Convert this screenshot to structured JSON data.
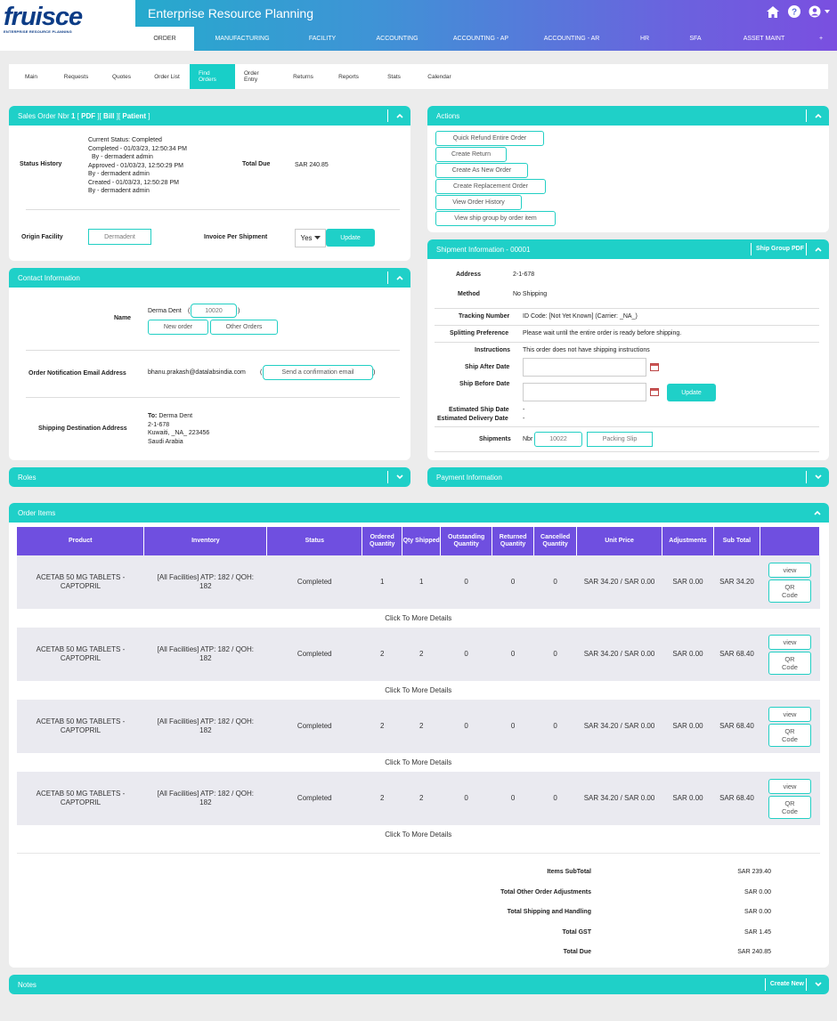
{
  "brand": {
    "logo": "fruisce",
    "tagline": "ENTERPRISE RESOURCE PLANNING"
  },
  "app_title": "Enterprise Resource Planning",
  "main_nav": [
    "ORDER",
    "MANUFACTURING",
    "FACILITY",
    "ACCOUNTING",
    "ACCOUNTING - AP",
    "ACCOUNTING - AR",
    "HR",
    "SFA",
    "ASSET MAINT",
    "+"
  ],
  "sub_nav": [
    "Main",
    "Requests",
    "Quotes",
    "Order List",
    "Find Orders",
    "Order Entry",
    "Returns",
    "Reports",
    "Stats",
    "Calendar"
  ],
  "sales_order": {
    "title_prefix": "Sales Order Nbr",
    "nbr": "1",
    "pdf": "PDF",
    "bill": "Bill",
    "patient": "Patient",
    "status_label": "Status History",
    "status_lines": [
      "Current Status: Completed",
      "Completed - 01/03/23, 12:50:34 PM",
      "By - dermadent admin",
      "Approved - 01/03/23, 12:50:29 PM",
      "By - dermadent admin",
      "Created - 01/03/23, 12:50:28 PM",
      "By - dermadent admin"
    ],
    "total_due_label": "Total Due",
    "total_due": "SAR 240.85",
    "origin_label": "Origin Facility",
    "origin_value": "Dermadent",
    "invoice_label": "Invoice Per Shipment",
    "invoice_value": "Yes",
    "update": "Update"
  },
  "contact": {
    "title": "Contact Information",
    "name_label": "Name",
    "name": "Derma Dent",
    "party_id": "10020",
    "new_order": "New order",
    "other_orders": "Other Orders",
    "email_label": "Order Notification Email Address",
    "email": "bhanu.prakash@datalabsindia.com",
    "send_email": "Send a confirmation email",
    "ship_label": "Shipping Destination Address",
    "to_label": "To:",
    "to_name": "Derma Dent",
    "addr": [
      "2-1-678",
      "Kuwaiti, _NA_ 223456",
      "Saudi Arabia"
    ]
  },
  "roles": {
    "title": "Roles"
  },
  "actions": {
    "title": "Actions",
    "buttons": [
      "Quick Refund Entire Order",
      "Create Return",
      "Create As New Order",
      "Create Replacement Order",
      "View Order History",
      "View ship group by order item"
    ]
  },
  "shipment": {
    "title": "Shipment Information - 00001",
    "pdf": "Ship Group PDF",
    "address_label": "Address",
    "address": "2-1-678",
    "method_label": "Method",
    "method": "No Shipping",
    "tracking_label": "Tracking Number",
    "tracking": "ID Code: [Not Yet Known] (Carrier: _NA_)",
    "split_label": "Splitting Preference",
    "split": "Please wait until the entire order is ready before shipping.",
    "instr_label": "Instructions",
    "instr": "This order does not have shipping instructions",
    "after_label": "Ship After Date",
    "before_label": "Ship Before Date",
    "update": "Update",
    "est_ship_label": "Estimated Ship Date",
    "est_ship": "-",
    "est_deliv_label": "Estimated Delivery Date",
    "est_deliv": "-",
    "shipments_label": "Shipments",
    "nbr_label": "Nbr",
    "nbr": "10022",
    "packing": "Packing Slip"
  },
  "payment": {
    "title": "Payment Information"
  },
  "order_items": {
    "title": "Order Items",
    "headers": [
      "Product",
      "Inventory",
      "Status",
      "Ordered Quantity",
      "Qty Shipped",
      "Outstanding Quantity",
      "Returned Quantity",
      "Cancelled Quantity",
      "Unit Price",
      "Adjustments",
      "Sub Total",
      ""
    ],
    "rows": [
      {
        "product": "ACETAB 50 MG TABLETS - CAPTOPRIL",
        "inventory": "[All Facilities] ATP: 182 / QOH: 182",
        "status": "Completed",
        "ordered": "1",
        "shipped": "1",
        "outstanding": "0",
        "returned": "0",
        "cancelled": "0",
        "unit_price": "SAR 34.20 / SAR 0.00",
        "adjustments": "SAR 0.00",
        "subtotal": "SAR 34.20"
      },
      {
        "product": "ACETAB 50 MG TABLETS - CAPTOPRIL",
        "inventory": "[All Facilities] ATP: 182 / QOH: 182",
        "status": "Completed",
        "ordered": "2",
        "shipped": "2",
        "outstanding": "0",
        "returned": "0",
        "cancelled": "0",
        "unit_price": "SAR 34.20 / SAR 0.00",
        "adjustments": "SAR 0.00",
        "subtotal": "SAR 68.40"
      },
      {
        "product": "ACETAB 50 MG TABLETS - CAPTOPRIL",
        "inventory": "[All Facilities] ATP: 182 / QOH: 182",
        "status": "Completed",
        "ordered": "2",
        "shipped": "2",
        "outstanding": "0",
        "returned": "0",
        "cancelled": "0",
        "unit_price": "SAR 34.20 / SAR 0.00",
        "adjustments": "SAR 0.00",
        "subtotal": "SAR 68.40"
      },
      {
        "product": "ACETAB 50 MG TABLETS - CAPTOPRIL",
        "inventory": "[All Facilities] ATP: 182 / QOH: 182",
        "status": "Completed",
        "ordered": "2",
        "shipped": "2",
        "outstanding": "0",
        "returned": "0",
        "cancelled": "0",
        "unit_price": "SAR 34.20 / SAR 0.00",
        "adjustments": "SAR 0.00",
        "subtotal": "SAR 68.40"
      }
    ],
    "view": "view",
    "qr": "QR Code",
    "more": "Click To More Details",
    "totals": [
      {
        "label": "Items SubTotal",
        "value": "SAR 239.40"
      },
      {
        "label": "Total Other Order Adjustments",
        "value": "SAR 0.00"
      },
      {
        "label": "Total Shipping and Handling",
        "value": "SAR 0.00"
      },
      {
        "label": "Total GST",
        "value": "SAR 1.45"
      },
      {
        "label": "Total Due",
        "value": "SAR 240.85"
      }
    ]
  },
  "notes": {
    "title": "Notes",
    "create": "Create New"
  }
}
